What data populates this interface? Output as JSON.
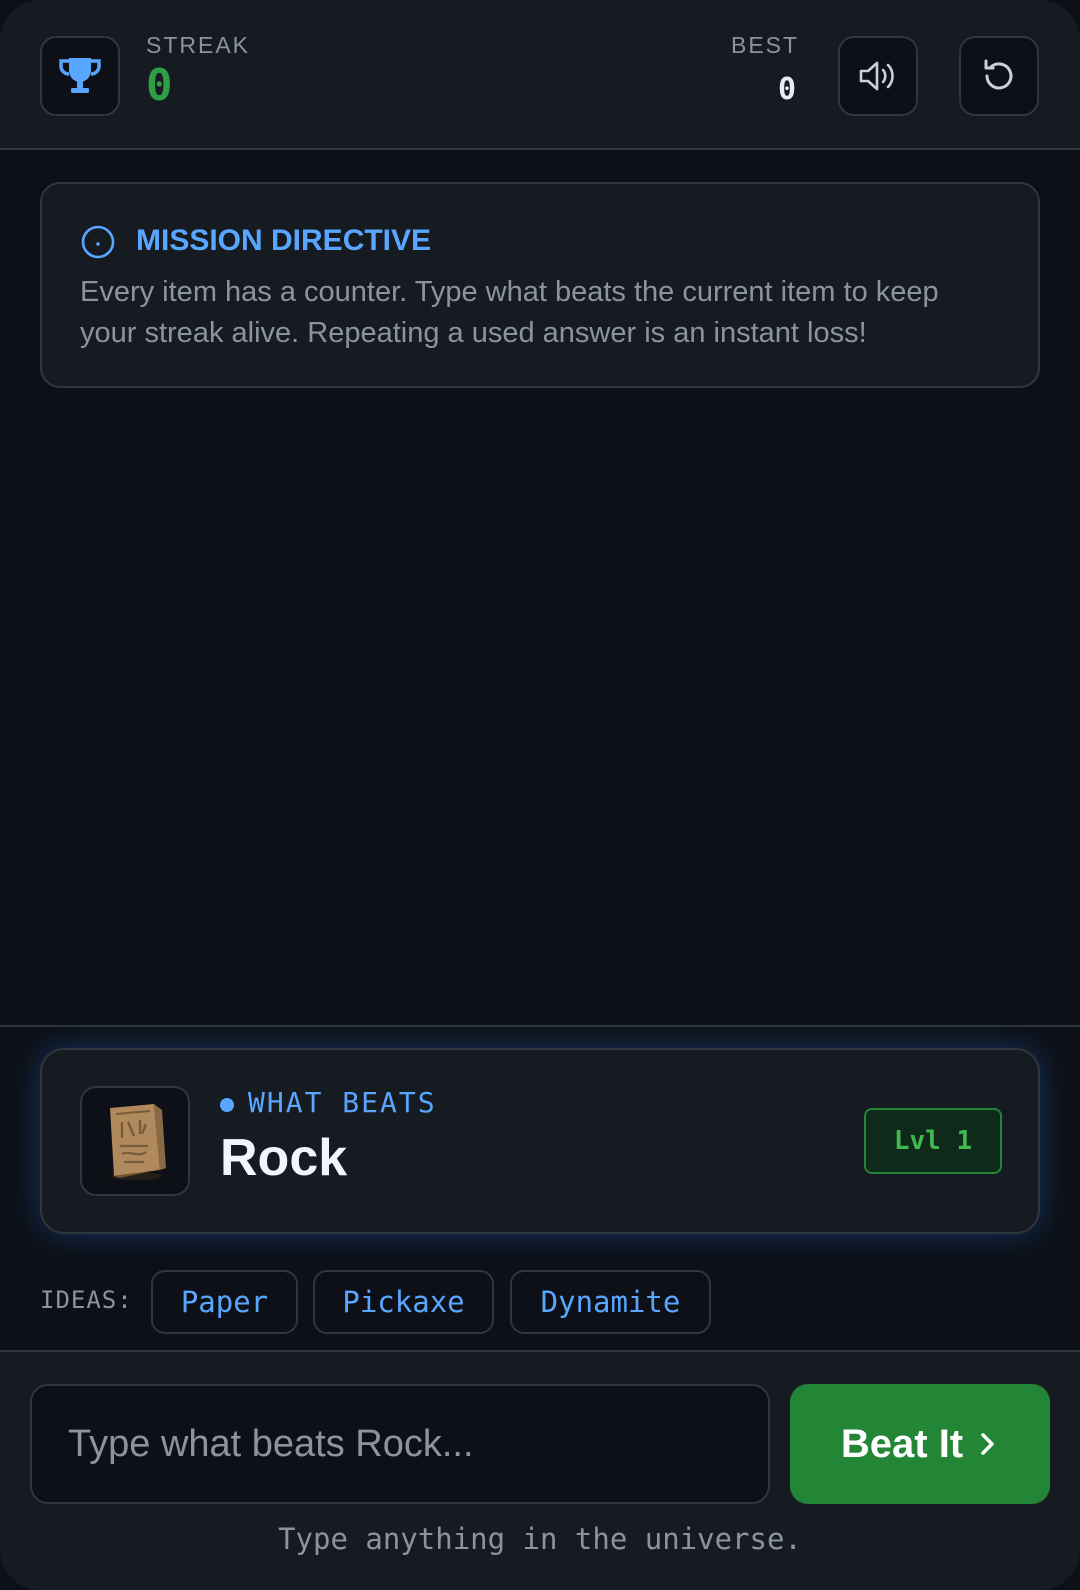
{
  "header": {
    "streak_label": "STREAK",
    "streak_value": "0",
    "best_label": "BEST",
    "best_value": "0",
    "icons": [
      "trophy-icon",
      "speaker-icon",
      "reset-icon"
    ]
  },
  "mission": {
    "icon": "info-icon",
    "title": "MISSION DIRECTIVE",
    "text": "Every item has a counter. Type what beats the current item to keep your streak alive. Repeating a used answer is an instant loss!"
  },
  "target": {
    "label": "WHAT BEATS",
    "item": "Rock",
    "level": "Lvl 1",
    "image": "stone-tablet-icon"
  },
  "ideas": {
    "label": "IDEAS:",
    "chips": [
      "Paper",
      "Pickaxe",
      "Dynamite"
    ]
  },
  "input": {
    "placeholder": "Type what beats Rock...",
    "value": "",
    "button_label": "Beat It",
    "hint": "Type anything in the universe."
  },
  "colors": {
    "background": "#0d1117",
    "panel": "#161b22",
    "accent_blue": "#58a6ff",
    "accent_green": "#238636",
    "streak_green": "#2ea043"
  }
}
